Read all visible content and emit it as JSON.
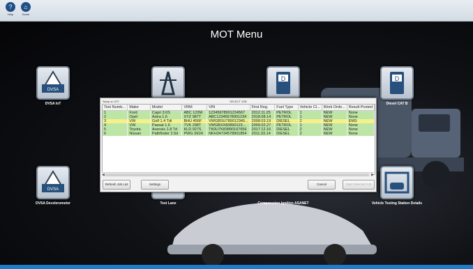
{
  "toolbar": {
    "items": [
      {
        "label": "Help",
        "icon": "help-icon"
      },
      {
        "label": "Home",
        "icon": "home-icon"
      }
    ]
  },
  "main": {
    "title": "MOT Menu",
    "tiles": [
      {
        "label": "DVSA IoT",
        "icon": "dvsa-warning-icon"
      },
      {
        "label": "",
        "icon": "tower-icon"
      },
      {
        "label": "",
        "icon": "diesel-pump-icon"
      },
      {
        "label": "Diesel CAT B",
        "icon": "diesel-pump-icon"
      },
      {
        "label": "DVSA Decelerometer",
        "icon": "dvsa-warning-icon"
      },
      {
        "label": "Test Lane",
        "icon": "test-lane-icon"
      },
      {
        "label": "Compression Ignition ASANET",
        "icon": "diesel-pump-icon"
      },
      {
        "label": "Vehicle Testing Station Details",
        "icon": "garage-icon"
      }
    ]
  },
  "dialog": {
    "caption": "Swap on IOT:",
    "title": "SELECT JOB",
    "columns": [
      "Test Numb...",
      "Make",
      "Model",
      "VRM",
      "VIN",
      "First Reg.",
      "Fuel Type",
      "Vehicle Cl...",
      "Work Orde...",
      "Result Posted"
    ],
    "rows": [
      [
        "1",
        "Ford",
        "Capri 3.0S",
        "ABC 123M",
        "12345678901234567",
        "2012.11.25",
        "PETROL",
        "1",
        "NEW",
        "None"
      ],
      [
        "2",
        "Opel",
        "Astra 1.6",
        "XYZ 987T",
        "ABC12345678901234",
        "2018.08.14",
        "PETROL",
        "1",
        "NEW",
        "None"
      ],
      [
        "3",
        "VW",
        "Golf 1.4 Tdi",
        "BHU 456F",
        "VWGBSU789012345...",
        "2008.03.19",
        "DIESEL",
        "2",
        "NEW",
        "EMS"
      ],
      [
        "4",
        "VW",
        "Passat 1.6",
        "TVK 298T",
        "VWGBXX83890123...",
        "2009.02.27",
        "PETROL",
        "1",
        "NEW",
        "None"
      ],
      [
        "5",
        "Toyota",
        "Avensis 1.8 Td",
        "KLD 927S",
        "TK0U7K83890167656",
        "2017.12.16",
        "DIESEL",
        "2",
        "NEW",
        "None"
      ],
      [
        "6",
        "Nissan",
        "Pathfinder 2.5d",
        "PWG 391R",
        "NKH34734578901854",
        "2011.03.14",
        "DIESEL",
        "2",
        "NEW",
        "None"
      ]
    ],
    "buttons": {
      "refresh": "Refresh Job List",
      "settings": "Settings",
      "cancel": "Cancel",
      "start": "Start Selected Job"
    },
    "colors": {
      "row": "#bde5a6",
      "selected_row": "#f4f08a"
    }
  }
}
